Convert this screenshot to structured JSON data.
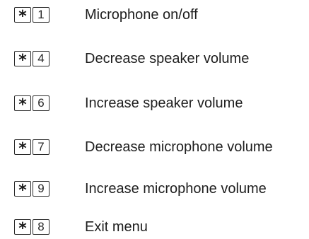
{
  "shortcuts": [
    {
      "symbol": "*",
      "digit": "1",
      "label": "Microphone on/off"
    },
    {
      "symbol": "*",
      "digit": "4",
      "label": "Decrease speaker volume"
    },
    {
      "symbol": "*",
      "digit": "6",
      "label": "Increase speaker volume"
    },
    {
      "symbol": "*",
      "digit": "7",
      "label": "Decrease microphone volume"
    },
    {
      "symbol": "*",
      "digit": "9",
      "label": "Increase microphone volume"
    },
    {
      "symbol": "*",
      "digit": "8",
      "label": "Exit menu"
    }
  ]
}
